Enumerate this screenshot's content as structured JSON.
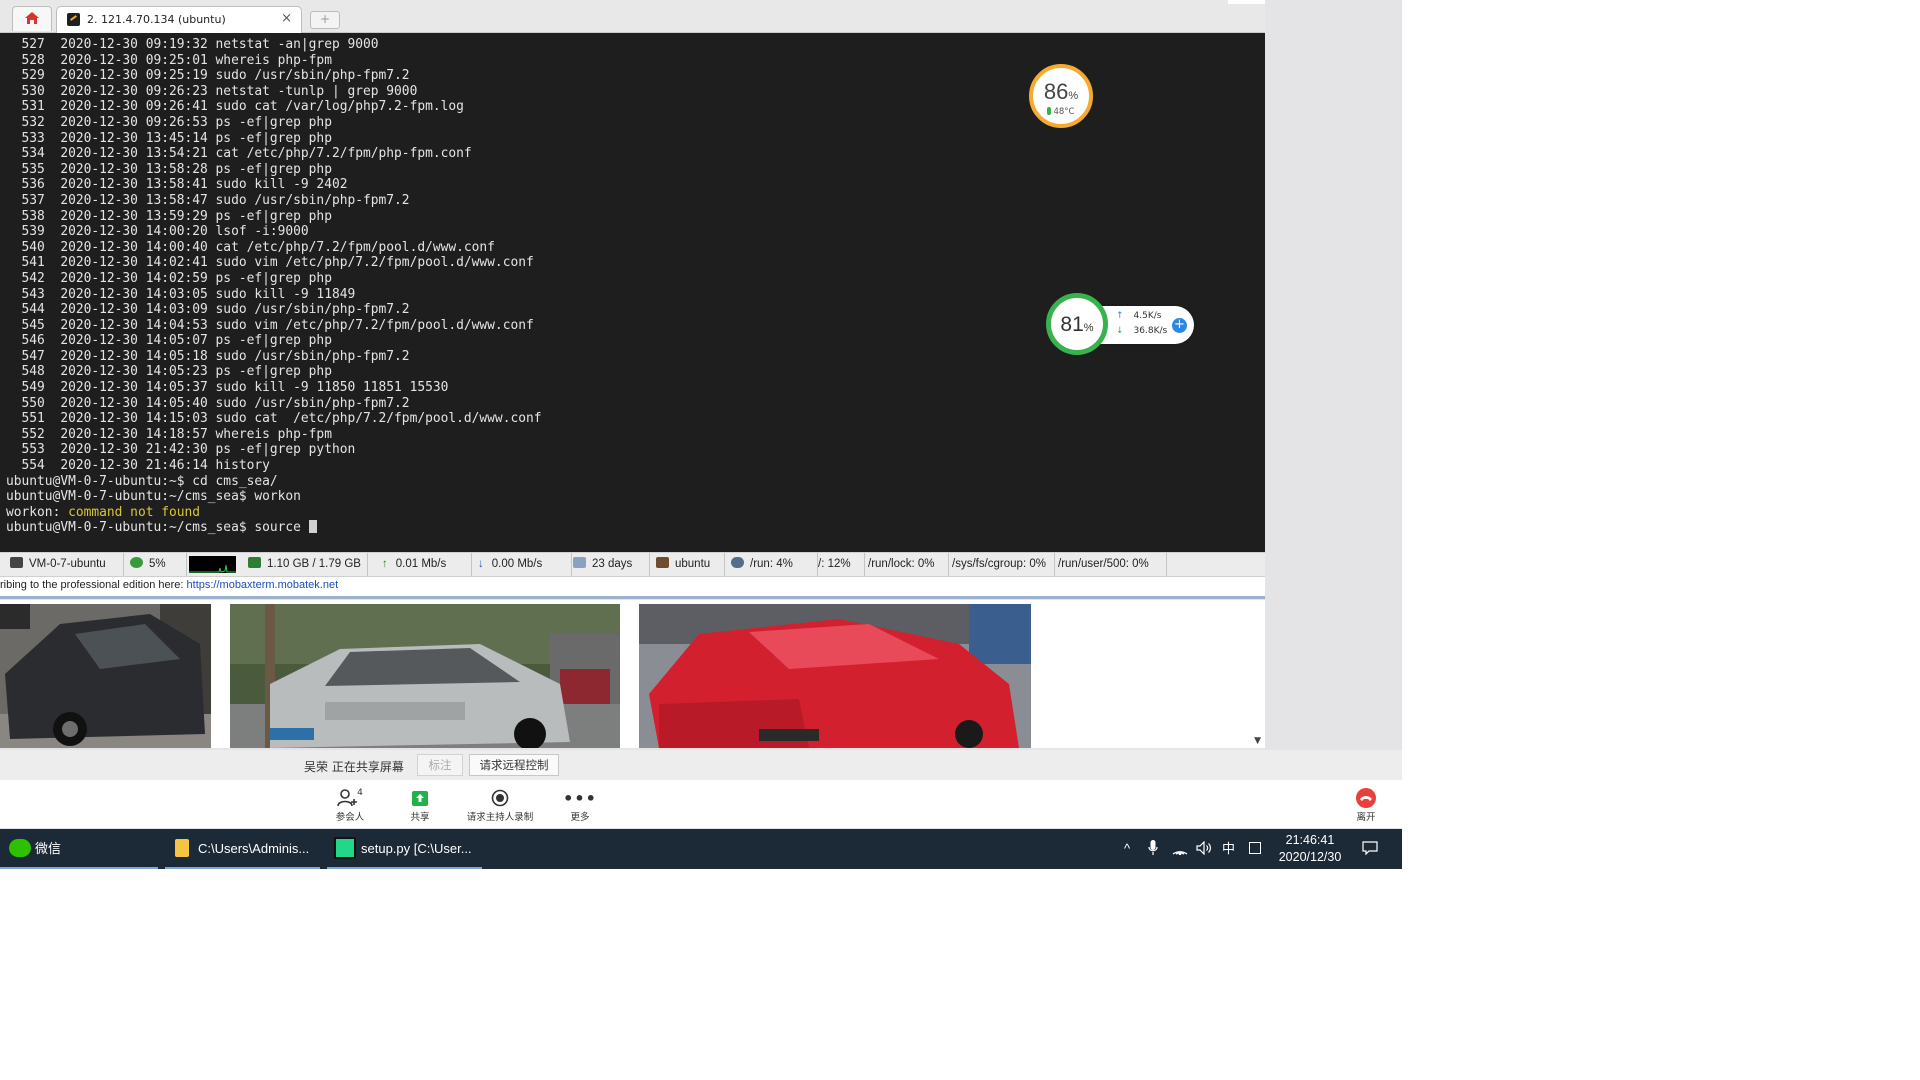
{
  "tabs": {
    "ssh_title": "2. 121.4.70.134 (ubuntu)",
    "close_glyph": "×",
    "new_tab_glyph": "+"
  },
  "terminal": {
    "lines": [
      "  527  2020-12-30 09:19:32 netstat -an|grep 9000",
      "  528  2020-12-30 09:25:01 whereis php-fpm",
      "  529  2020-12-30 09:25:19 sudo /usr/sbin/php-fpm7.2",
      "  530  2020-12-30 09:26:23 netstat -tunlp | grep 9000",
      "  531  2020-12-30 09:26:41 sudo cat /var/log/php7.2-fpm.log",
      "  532  2020-12-30 09:26:53 ps -ef|grep php",
      "  533  2020-12-30 13:45:14 ps -ef|grep php",
      "  534  2020-12-30 13:54:21 cat /etc/php/7.2/fpm/php-fpm.conf",
      "  535  2020-12-30 13:58:28 ps -ef|grep php",
      "  536  2020-12-30 13:58:41 sudo kill -9 2402",
      "  537  2020-12-30 13:58:47 sudo /usr/sbin/php-fpm7.2",
      "  538  2020-12-30 13:59:29 ps -ef|grep php",
      "  539  2020-12-30 14:00:20 lsof -i:9000",
      "  540  2020-12-30 14:00:40 cat /etc/php/7.2/fpm/pool.d/www.conf",
      "  541  2020-12-30 14:02:41 sudo vim /etc/php/7.2/fpm/pool.d/www.conf",
      "  542  2020-12-30 14:02:59 ps -ef|grep php",
      "  543  2020-12-30 14:03:05 sudo kill -9 11849",
      "  544  2020-12-30 14:03:09 sudo /usr/sbin/php-fpm7.2",
      "  545  2020-12-30 14:04:53 sudo vim /etc/php/7.2/fpm/pool.d/www.conf",
      "  546  2020-12-30 14:05:07 ps -ef|grep php",
      "  547  2020-12-30 14:05:18 sudo /usr/sbin/php-fpm7.2",
      "  548  2020-12-30 14:05:23 ps -ef|grep php",
      "  549  2020-12-30 14:05:37 sudo kill -9 11850 11851 15530",
      "  550  2020-12-30 14:05:40 sudo /usr/sbin/php-fpm7.2",
      "  551  2020-12-30 14:15:03 sudo cat  /etc/php/7.2/fpm/pool.d/www.conf",
      "  552  2020-12-30 14:18:57 whereis php-fpm",
      "  553  2020-12-30 21:42:30 ps -ef|grep python",
      "  554  2020-12-30 21:46:14 history",
      "ubuntu@VM-0-7-ubuntu:~$ cd cms_sea/",
      "ubuntu@VM-0-7-ubuntu:~/cms_sea$ workon"
    ],
    "error_prefix": "workon: ",
    "error_text": "command not found",
    "prompt_line": "ubuntu@VM-0-7-ubuntu:~/cms_sea$ source "
  },
  "statusbar": {
    "host": "VM-0-7-ubuntu",
    "cpu": "5%",
    "memory": "1.10 GB / 1.79 GB",
    "upload": "0.01 Mb/s",
    "download": "0.00 Mb/s",
    "uptime": "23 days",
    "user": "ubuntu",
    "disks": [
      "/run: 4%",
      "/: 12%",
      "/run/lock: 0%",
      "/sys/fs/cgroup: 0%",
      "/run/user/500: 0%"
    ]
  },
  "infobar": {
    "text": "ribing to the professional edition here:",
    "link": "https://mobaxterm.mobatek.net"
  },
  "meeting": {
    "sharing_text": "吴荣 正在共享屏幕",
    "mark_button": "标注",
    "remote_button": "请求远程控制",
    "participants_label": "参会人",
    "participants_count": "4",
    "share_label": "共享",
    "record_label": "请求主持人录制",
    "more_label": "更多",
    "leave_label": "离开"
  },
  "widgets": {
    "cpu_percent": "86",
    "cpu_temp": "48°C",
    "mem_percent": "81",
    "up_speed": "4.5K/s",
    "down_speed": "36.8K/s",
    "percent_sign": "%"
  },
  "taskbar": {
    "wechat": "微信",
    "explorer": "C:\\Users\\Adminis...",
    "pycharm": "setup.py [C:\\User...",
    "ime": "中",
    "time": "21:46:41",
    "date": "2020/12/30"
  },
  "colors": {
    "terminal_bg": "#1e1e1e",
    "warn": "#d7c53a",
    "taskbar_bg": "#1c2937",
    "gauge_orange": "#f5ab2f",
    "gauge_green": "#37b24d",
    "leave_red": "#e8403a"
  }
}
